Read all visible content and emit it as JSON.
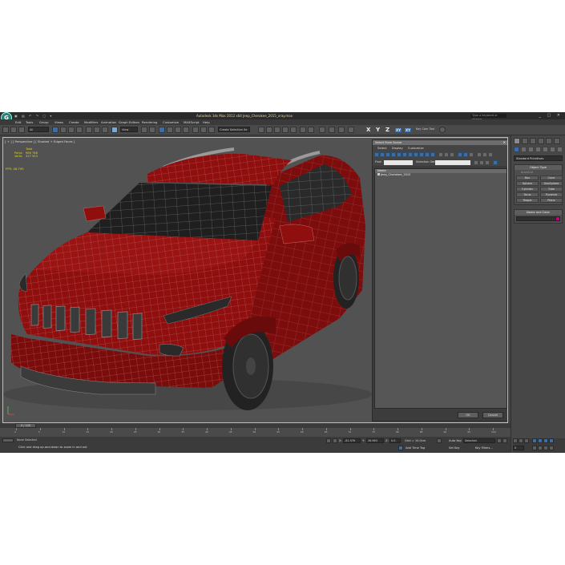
{
  "titlebar": {
    "app_title": "Autodesk 3ds Max  2012 x64    Jeep_Cherokee_2015_vray.max",
    "search_placeholder": "Type a keyword or phrase",
    "logo_letter": "G"
  },
  "menu": [
    "Edit",
    "Tools",
    "Group",
    "Views",
    "Create",
    "Modifiers",
    "Animation",
    "Graph Editors",
    "Rendering",
    "Customize",
    "MAXScript",
    "Help"
  ],
  "toolbar": {
    "filter_value": "All",
    "ref_coord_value": "View",
    "named_selection_placeholder": "Create Selection Se",
    "axis_labels": [
      "X",
      "Y",
      "Z",
      "XY",
      "XY"
    ],
    "key_tool_label": "Key Cam Tool"
  },
  "viewport": {
    "label": "[ + ] [ Perspective ] [ Shaded + Edged Faces ]",
    "stats": {
      "heading": "Total",
      "rows": [
        {
          "label": "Polys:",
          "value": "986 788"
        },
        {
          "label": "Verts:",
          "value": "317 553"
        }
      ],
      "fps_label": "FPS:",
      "fps_value": "46.795"
    },
    "car_paint_color": "#8f0f0f",
    "wire_color": "#c46b6b"
  },
  "select_dialog": {
    "title": "Select From Scene",
    "menu": [
      "Select",
      "Display",
      "Customize"
    ],
    "find_label": "Find:",
    "selection_set_label": "Selection Set:",
    "column_header": "Name",
    "items": [
      "Jeep_Cherokee_2015"
    ],
    "ok_label": "OK",
    "cancel_label": "Cancel"
  },
  "command_panel": {
    "category_dropdown": "Standard Primitives",
    "object_type_header": "Object Type",
    "autogrid_label": "AutoGrid",
    "object_buttons": [
      "Box",
      "Cone",
      "Sphere",
      "GeoSphere",
      "Cylinder",
      "Tube",
      "Torus",
      "Pyramid",
      "Teapot",
      "Plane"
    ],
    "name_color_header": "Name and Color",
    "object_color": "#c5007a"
  },
  "timeline": {
    "slider_label": "0 / 100",
    "ticks": [
      "0",
      "5",
      "10",
      "15",
      "20",
      "25",
      "30",
      "35",
      "40",
      "45",
      "50",
      "55",
      "60",
      "65",
      "70",
      "75",
      "80",
      "85",
      "90",
      "95",
      "100"
    ]
  },
  "status": {
    "selection_text": "None Selected",
    "prompt_text": "Click and drag up-and-down to zoom in and out",
    "max_to_physical": "Max to",
    "x_label": "X:",
    "x_value": "-81.976",
    "y_label": "Y:",
    "y_value": "26.963",
    "z_label": "Z:",
    "z_value": "0.0",
    "grid_text": "Grid = 10.0cm",
    "add_time_tag": "Add Time Tag",
    "auto_key": "Auto Key",
    "set_key": "Set Key",
    "selected_value": "Selected",
    "key_filters": "Key Filters...",
    "frame_value": "0"
  }
}
